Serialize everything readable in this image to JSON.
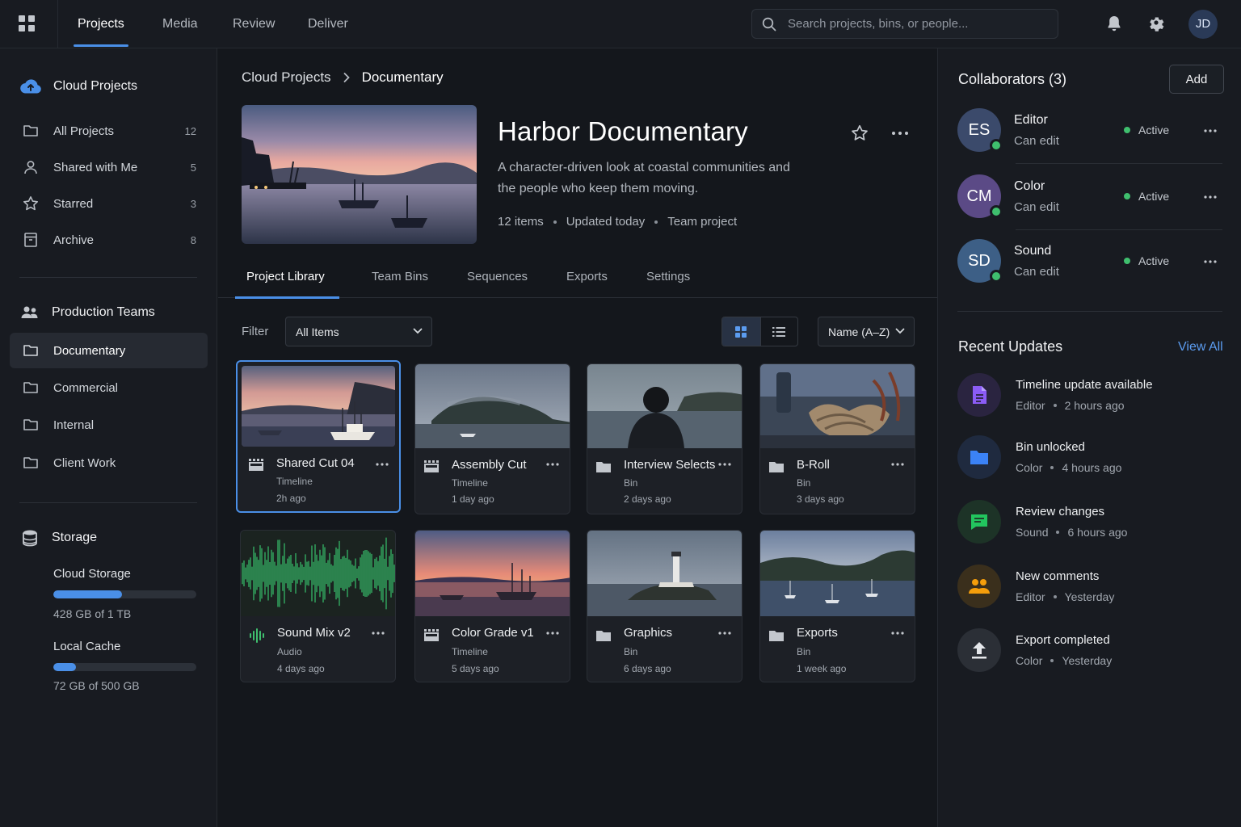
{
  "topnav": {
    "tabs": [
      {
        "label": "Projects",
        "active": true
      },
      {
        "label": "Media",
        "active": false
      },
      {
        "label": "Review",
        "active": false
      },
      {
        "label": "Deliver",
        "active": false
      }
    ],
    "search_placeholder": "Search projects, bins, or people...",
    "user_initials": "JD",
    "icons": [
      "apps-grid-icon",
      "search-icon",
      "bell-icon",
      "gear-icon"
    ]
  },
  "sidebar": {
    "header": "Cloud Projects",
    "items": [
      {
        "label": "All Projects",
        "count": "12",
        "icon": "folder-icon"
      },
      {
        "label": "Shared with Me",
        "count": "5",
        "icon": "person-icon"
      },
      {
        "label": "Starred",
        "count": "3",
        "icon": "star-icon"
      },
      {
        "label": "Archive",
        "count": "8",
        "icon": "archive-icon"
      }
    ],
    "teams_header": "Production Teams",
    "teams": [
      {
        "label": "Documentary",
        "active": true
      },
      {
        "label": "Commercial",
        "active": false
      },
      {
        "label": "Internal",
        "active": false
      },
      {
        "label": "Client Work",
        "active": false
      }
    ],
    "storage": {
      "header": "Storage",
      "cloud_label": "Cloud Storage",
      "cloud_usage": "428 GB of 1 TB",
      "cloud_fraction": 0.48,
      "local_label": "Local Cache",
      "local_usage": "72 GB of 500 GB",
      "local_fraction": 0.16
    }
  },
  "main": {
    "breadcrumb": [
      "Cloud Projects",
      "Documentary"
    ],
    "project": {
      "title": "Harbor Documentary",
      "description": "A character-driven look at coastal communities and the people who keep them moving.",
      "meta": [
        "12 items",
        "Updated today",
        "Team project"
      ]
    },
    "tabs": [
      {
        "label": "Project Library",
        "active": true
      },
      {
        "label": "Team Bins",
        "active": false
      },
      {
        "label": "Sequences",
        "active": false
      },
      {
        "label": "Exports",
        "active": false
      },
      {
        "label": "Settings",
        "active": false
      }
    ],
    "filter_label": "Filter",
    "filter_value": "All Items",
    "sort_value": "Name (A–Z)",
    "view_mode": "grid",
    "items": [
      {
        "name": "Shared Cut 04",
        "kind": "Timeline",
        "date": "2h ago",
        "icon": "timeline-icon",
        "selected": true
      },
      {
        "name": "Assembly Cut",
        "kind": "Timeline",
        "date": "1 day ago",
        "icon": "timeline-icon",
        "selected": false
      },
      {
        "name": "Interview Selects",
        "kind": "Bin",
        "date": "2 days ago",
        "icon": "bin-folder-icon",
        "selected": false
      },
      {
        "name": "B-Roll",
        "kind": "Bin",
        "date": "3 days ago",
        "icon": "bin-folder-icon",
        "selected": false
      },
      {
        "name": "Sound Mix v2",
        "kind": "Audio",
        "date": "4 days ago",
        "icon": "audio-icon",
        "selected": false
      },
      {
        "name": "Color Grade v1",
        "kind": "Timeline",
        "date": "5 days ago",
        "icon": "timeline-icon",
        "selected": false
      },
      {
        "name": "Graphics",
        "kind": "Bin",
        "date": "6 days ago",
        "icon": "bin-folder-icon",
        "selected": false
      },
      {
        "name": "Exports",
        "kind": "Bin",
        "date": "1 week ago",
        "icon": "bin-folder-icon",
        "selected": false
      }
    ]
  },
  "collaborators": {
    "title": "Collaborators (3)",
    "add_label": "Add",
    "people": [
      {
        "initials": "ES",
        "name": "Editor",
        "role": "Can edit",
        "status": "Active",
        "color": "#3b4a6b"
      },
      {
        "initials": "CM",
        "name": "Color",
        "role": "Can edit",
        "status": "Active",
        "color": "#5b4a86"
      },
      {
        "initials": "SD",
        "name": "Sound",
        "role": "Can edit",
        "status": "Active",
        "color": "#3d5f86"
      }
    ]
  },
  "updates": {
    "title": "Recent Updates",
    "view_all": "View All",
    "items": [
      {
        "title": "Timeline update available",
        "who": "Editor",
        "when": "2 hours ago",
        "icon": "document-icon",
        "color": "#8b5cf6",
        "bg": "#2a2440"
      },
      {
        "title": "Bin unlocked",
        "who": "Color",
        "when": "4 hours ago",
        "icon": "folder-icon",
        "color": "#3b82f6",
        "bg": "#1f2a3f"
      },
      {
        "title": "Review changes",
        "who": "Sound",
        "when": "6 hours ago",
        "icon": "chat-icon",
        "color": "#22c55e",
        "bg": "#1d3327"
      },
      {
        "title": "New comments",
        "who": "Editor",
        "when": "Yesterday",
        "icon": "people-icon",
        "color": "#f59e0b",
        "bg": "#3a2f1c"
      },
      {
        "title": "Export completed",
        "who": "Color",
        "when": "Yesterday",
        "icon": "upload-icon",
        "color": "#e5e7eb",
        "bg": "#2b2f36"
      }
    ]
  }
}
